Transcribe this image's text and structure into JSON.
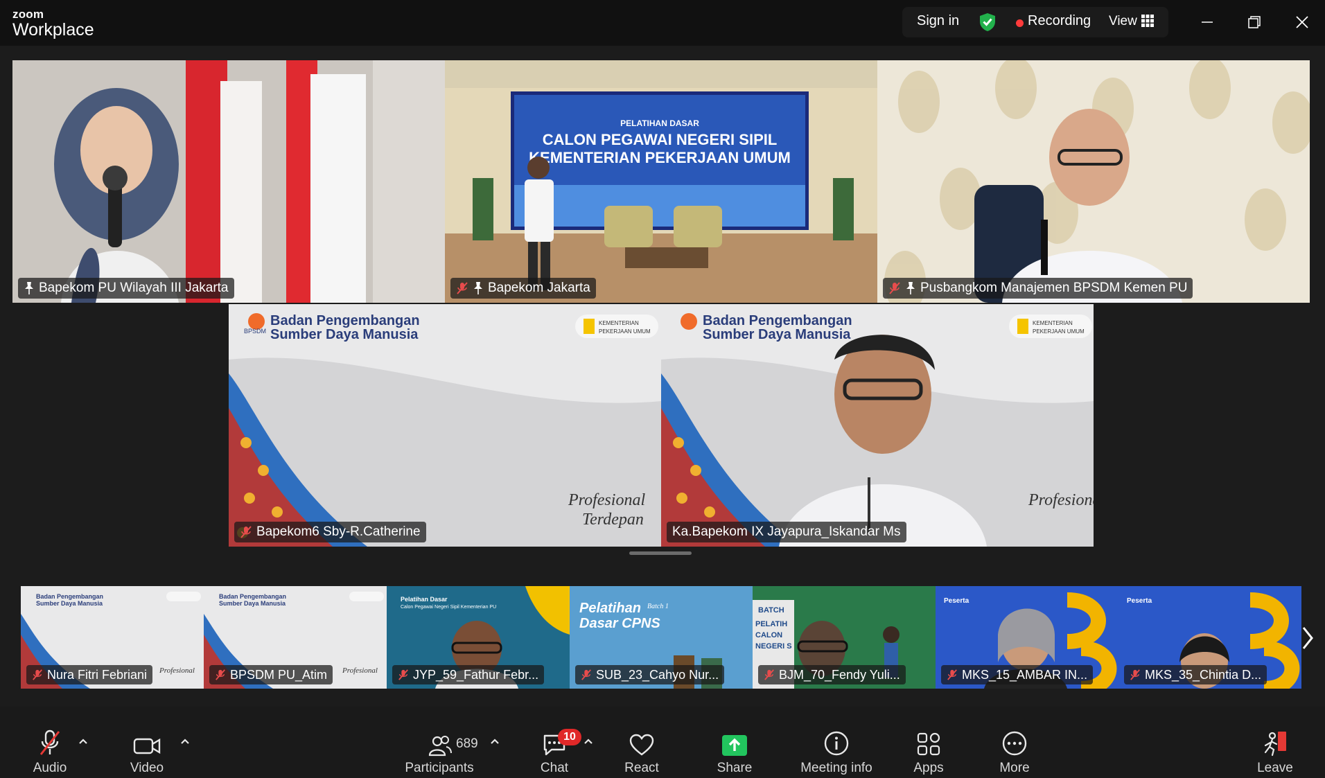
{
  "app": {
    "brand_top": "zoom",
    "brand_bottom": "Workplace"
  },
  "titlebar": {
    "sign_in": "Sign in",
    "recording": "Recording",
    "view": "View",
    "accent_green": "#22b14c",
    "record_color": "#ff3b3b"
  },
  "gallery": {
    "tiles": [
      {
        "name": "Bapekom PU Wilayah III Jakarta",
        "muted": false
      },
      {
        "name": "Bapekom Jakarta",
        "muted": true
      },
      {
        "name": "Pusbangkom Manajemen BPSDM Kemen PU",
        "muted": true
      },
      {
        "name": "Bapekom6 Sby-R.Catherine",
        "muted": true
      },
      {
        "name": "Ka.Bapekom IX Jayapura_Iskandar Ms",
        "muted": false,
        "active_speaker": true
      }
    ],
    "slide_title_1": "PELATIHAN DASAR",
    "slide_title_2": "CALON PEGAWAI NEGERI SIPIL",
    "slide_title_3": "KEMENTERIAN PEKERJAAN UMUM",
    "bpsdm_1": "Badan Pengembangan",
    "bpsdm_2": "Sumber Daya Manusia",
    "bpsdm_short": "BPSDM",
    "kemen_1": "KEMENTERIAN",
    "kemen_2": "PEKERJAAN UMUM",
    "motto_1": "Profesional",
    "motto_2": "Terdepan"
  },
  "strip": {
    "participants": [
      {
        "name": "Nura Fitri Febriani"
      },
      {
        "name": "BPSDM PU_Atim"
      },
      {
        "name": "JYP_59_Fathur Febr..."
      },
      {
        "name": "SUB_23_Cahyo Nur..."
      },
      {
        "name": "BJM_70_Fendy Yuli..."
      },
      {
        "name": "MKS_15_AMBAR IN..."
      },
      {
        "name": "MKS_35_Chintia D..."
      }
    ],
    "t3_l1": "Pelatihan Dasar",
    "t3_l2": "Calon Pegawai Negeri Sipil Kementerian PU",
    "t4_l1": "Pelatihan",
    "t4_l2": "Dasar CPNS",
    "t4_batch": "Batch 1",
    "t5_l1": "BATCH",
    "t5_l2": "PELATIH",
    "t5_l3": "CALON",
    "t5_l4": "NEGERI S",
    "t6_l1": "Peserta"
  },
  "toolbar": {
    "audio": "Audio",
    "video": "Video",
    "participants": "Participants",
    "participants_count": "689",
    "chat": "Chat",
    "chat_badge": "10",
    "react": "React",
    "share": "Share",
    "meeting_info": "Meeting info",
    "apps": "Apps",
    "more": "More",
    "leave": "Leave",
    "share_color": "#22c55e",
    "leave_color": "#e53935"
  }
}
